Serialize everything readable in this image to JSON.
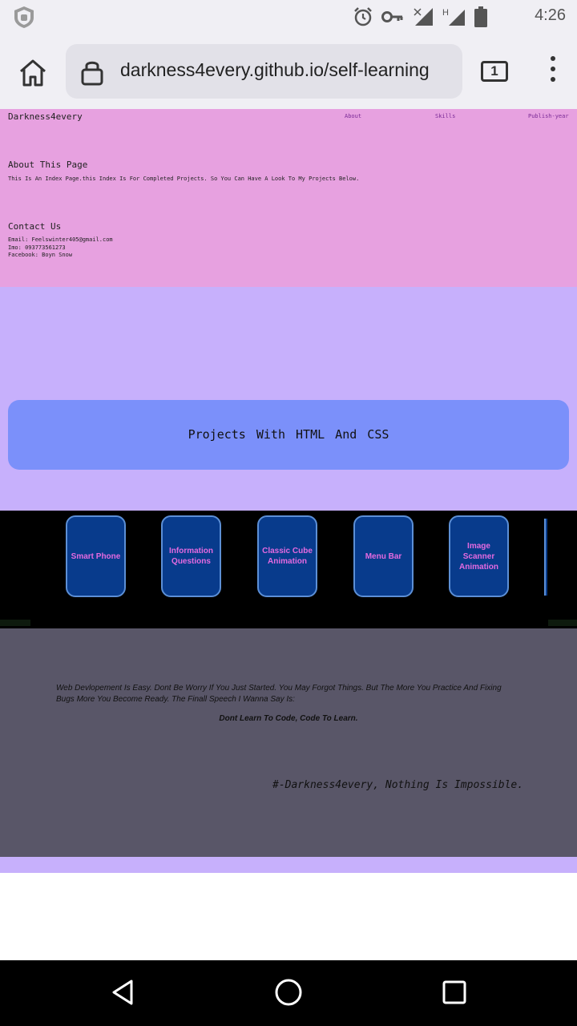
{
  "status_bar": {
    "time": "4:26",
    "icons": [
      "shield-icon",
      "alarm-icon",
      "key-icon",
      "signal-no-data-icon",
      "signal-h-icon",
      "battery-icon"
    ]
  },
  "browser": {
    "url": "darkness4every.github.io/self-learning",
    "tab_count": "1"
  },
  "page": {
    "brand": "Darkness4every",
    "nav": [
      "About",
      "Skills",
      "Publish-year"
    ],
    "about": {
      "heading": "About This Page",
      "text": "This Is An Index Page.this Index Is For Completed Projects. So You Can Have A Look To My Projects Below."
    },
    "contact": {
      "heading": "Contact Us",
      "email": "Email: Feelswinter405@gmail.com",
      "imo": "Imo: 093773561273",
      "facebook": "Facebook: Boyn Snow"
    },
    "projects_title": "Projects With  HTML  And  CSS",
    "projects": [
      "Smart Phone",
      "Information Questions",
      "Classic Cube Animation",
      "Menu Bar",
      "Image Scanner Animation"
    ],
    "quote": {
      "text": "Web Devlopement Is Easy. Dont Be Worry If You Just Started. You May Forgot Things. But The More You Practice And Fixing Bugs More You Become Ready. The Finall Speech I Wanna Say Is:",
      "emphasis": "Dont Learn To Code, Code To Learn.",
      "signature": "#-Darkness4every, Nothing Is Impossible."
    }
  },
  "colors": {
    "header_bg": "#e7a1e0",
    "page_bg": "#c7b0fc",
    "title_box": "#7b90fa",
    "card_bg": "#083b8c",
    "card_text": "#e46ae0",
    "quote_bg": "#595668"
  },
  "nav_bar": [
    "back-icon",
    "home-circle-icon",
    "recents-icon"
  ]
}
